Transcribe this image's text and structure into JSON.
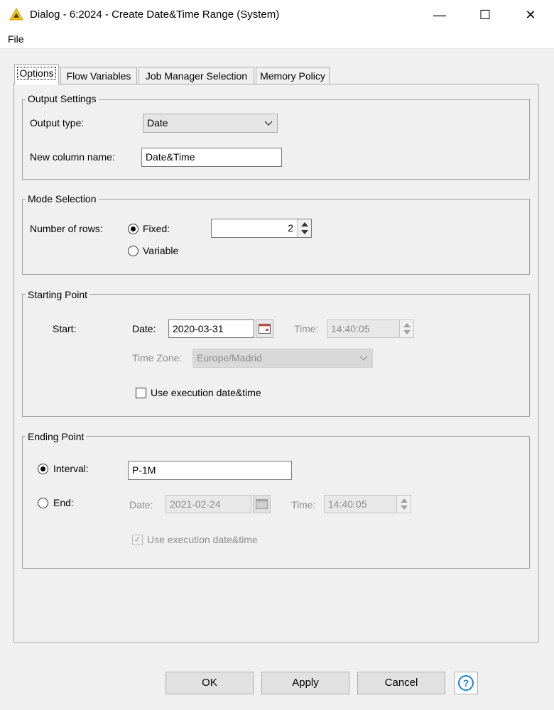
{
  "window": {
    "title": "Dialog - 6:2024 - Create Date&Time Range (System)",
    "minimize_glyph": "—",
    "maximize_glyph": "☐",
    "close_glyph": "✕",
    "icon": "knime-triangle-icon",
    "icon_color": "#f5c518"
  },
  "menu": {
    "file": "File"
  },
  "tabs": [
    {
      "label": "Options",
      "active": true
    },
    {
      "label": "Flow Variables"
    },
    {
      "label": "Job Manager Selection"
    },
    {
      "label": "Memory Policy"
    }
  ],
  "output_settings": {
    "legend": "Output Settings",
    "output_type_label": "Output type:",
    "output_type_value": "Date",
    "column_name_label": "New column name:",
    "column_name_value": "Date&Time"
  },
  "mode_selection": {
    "legend": "Mode Selection",
    "rows_label": "Number of rows:",
    "fixed_label": "Fixed:",
    "fixed_selected": true,
    "fixed_value": "2",
    "variable_label": "Variable"
  },
  "starting_point": {
    "legend": "Starting Point",
    "start_label": "Start:",
    "date_label": "Date:",
    "date_value": "2020-03-31",
    "time_label": "Time:",
    "time_value": "14:40:05",
    "timezone_label": "Time Zone:",
    "timezone_value": "Europe/Madrid",
    "use_exec_label": "Use execution date&time",
    "use_exec_checked": false
  },
  "ending_point": {
    "legend": "Ending Point",
    "interval_label": "Interval:",
    "interval_selected": true,
    "interval_value": "P-1M",
    "end_label": "End:",
    "date_label": "Date:",
    "date_value": "2021-02-24",
    "time_label": "Time:",
    "time_value": "14:40:05",
    "use_exec_label": "Use execution date&time",
    "use_exec_checked": true
  },
  "buttons": {
    "ok": "OK",
    "apply": "Apply",
    "cancel": "Cancel",
    "help": "?"
  },
  "colors": {
    "accent": "#1e7fd6",
    "titlebar": "#ffffff",
    "dialog_bg": "#f0f0f0"
  }
}
